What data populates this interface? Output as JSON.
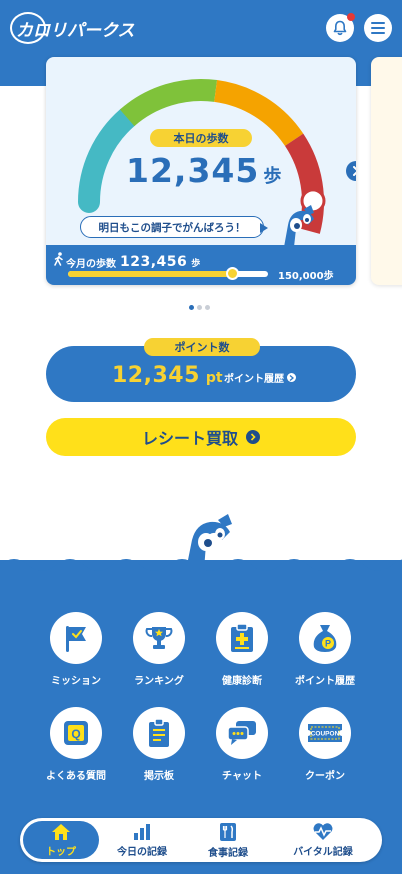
{
  "header": {
    "logo_text": "カロリパークス",
    "bell_icon": "bell-icon",
    "menu_icon": "menu-icon"
  },
  "steps_card": {
    "label": "本日の歩数",
    "value": "12,345",
    "unit": "歩",
    "message": "明日もこの調子でがんばろう！",
    "gauge_level": 0.92,
    "gauge_colors": [
      "#45b9c4",
      "#7fc23a",
      "#f5a300",
      "#c93a3a"
    ],
    "monthly": {
      "label": "今月の歩数",
      "value": "123,456",
      "unit": "歩",
      "goal": "150,000歩",
      "progress": 0.82
    }
  },
  "carousel": {
    "count": 3,
    "active": 0
  },
  "points": {
    "label": "ポイント数",
    "value": "12,345",
    "unit": "pt",
    "history_link": "ポイント履歴"
  },
  "receipt_button": {
    "label": "レシート買取"
  },
  "menu": [
    {
      "label": "ミッション",
      "icon": "flag-icon"
    },
    {
      "label": "ランキング",
      "icon": "trophy-icon"
    },
    {
      "label": "健康診断",
      "icon": "clipboard-plus-icon"
    },
    {
      "label": "ポイント履歴",
      "icon": "money-bag-icon"
    },
    {
      "label": "よくある質問",
      "icon": "faq-icon"
    },
    {
      "label": "掲示板",
      "icon": "board-icon"
    },
    {
      "label": "チャット",
      "icon": "chat-icon"
    },
    {
      "label": "クーポン",
      "icon": "coupon-icon"
    }
  ],
  "coupon_text": "COUPON",
  "faq_letter": "Q",
  "points_badge_letter": "P",
  "bottom_nav": [
    {
      "label": "トップ",
      "icon": "home-icon",
      "active": true
    },
    {
      "label": "今日の記録",
      "icon": "bar-chart-icon",
      "active": false
    },
    {
      "label": "食事記録",
      "icon": "meal-icon",
      "active": false
    },
    {
      "label": "バイタル記録",
      "icon": "heart-pulse-icon",
      "active": false
    }
  ],
  "colors": {
    "brand_blue": "#2f78c4",
    "accent_yellow": "#ffe01a",
    "badge_yellow": "#f7d233",
    "text_navy": "#1f4e8c"
  }
}
